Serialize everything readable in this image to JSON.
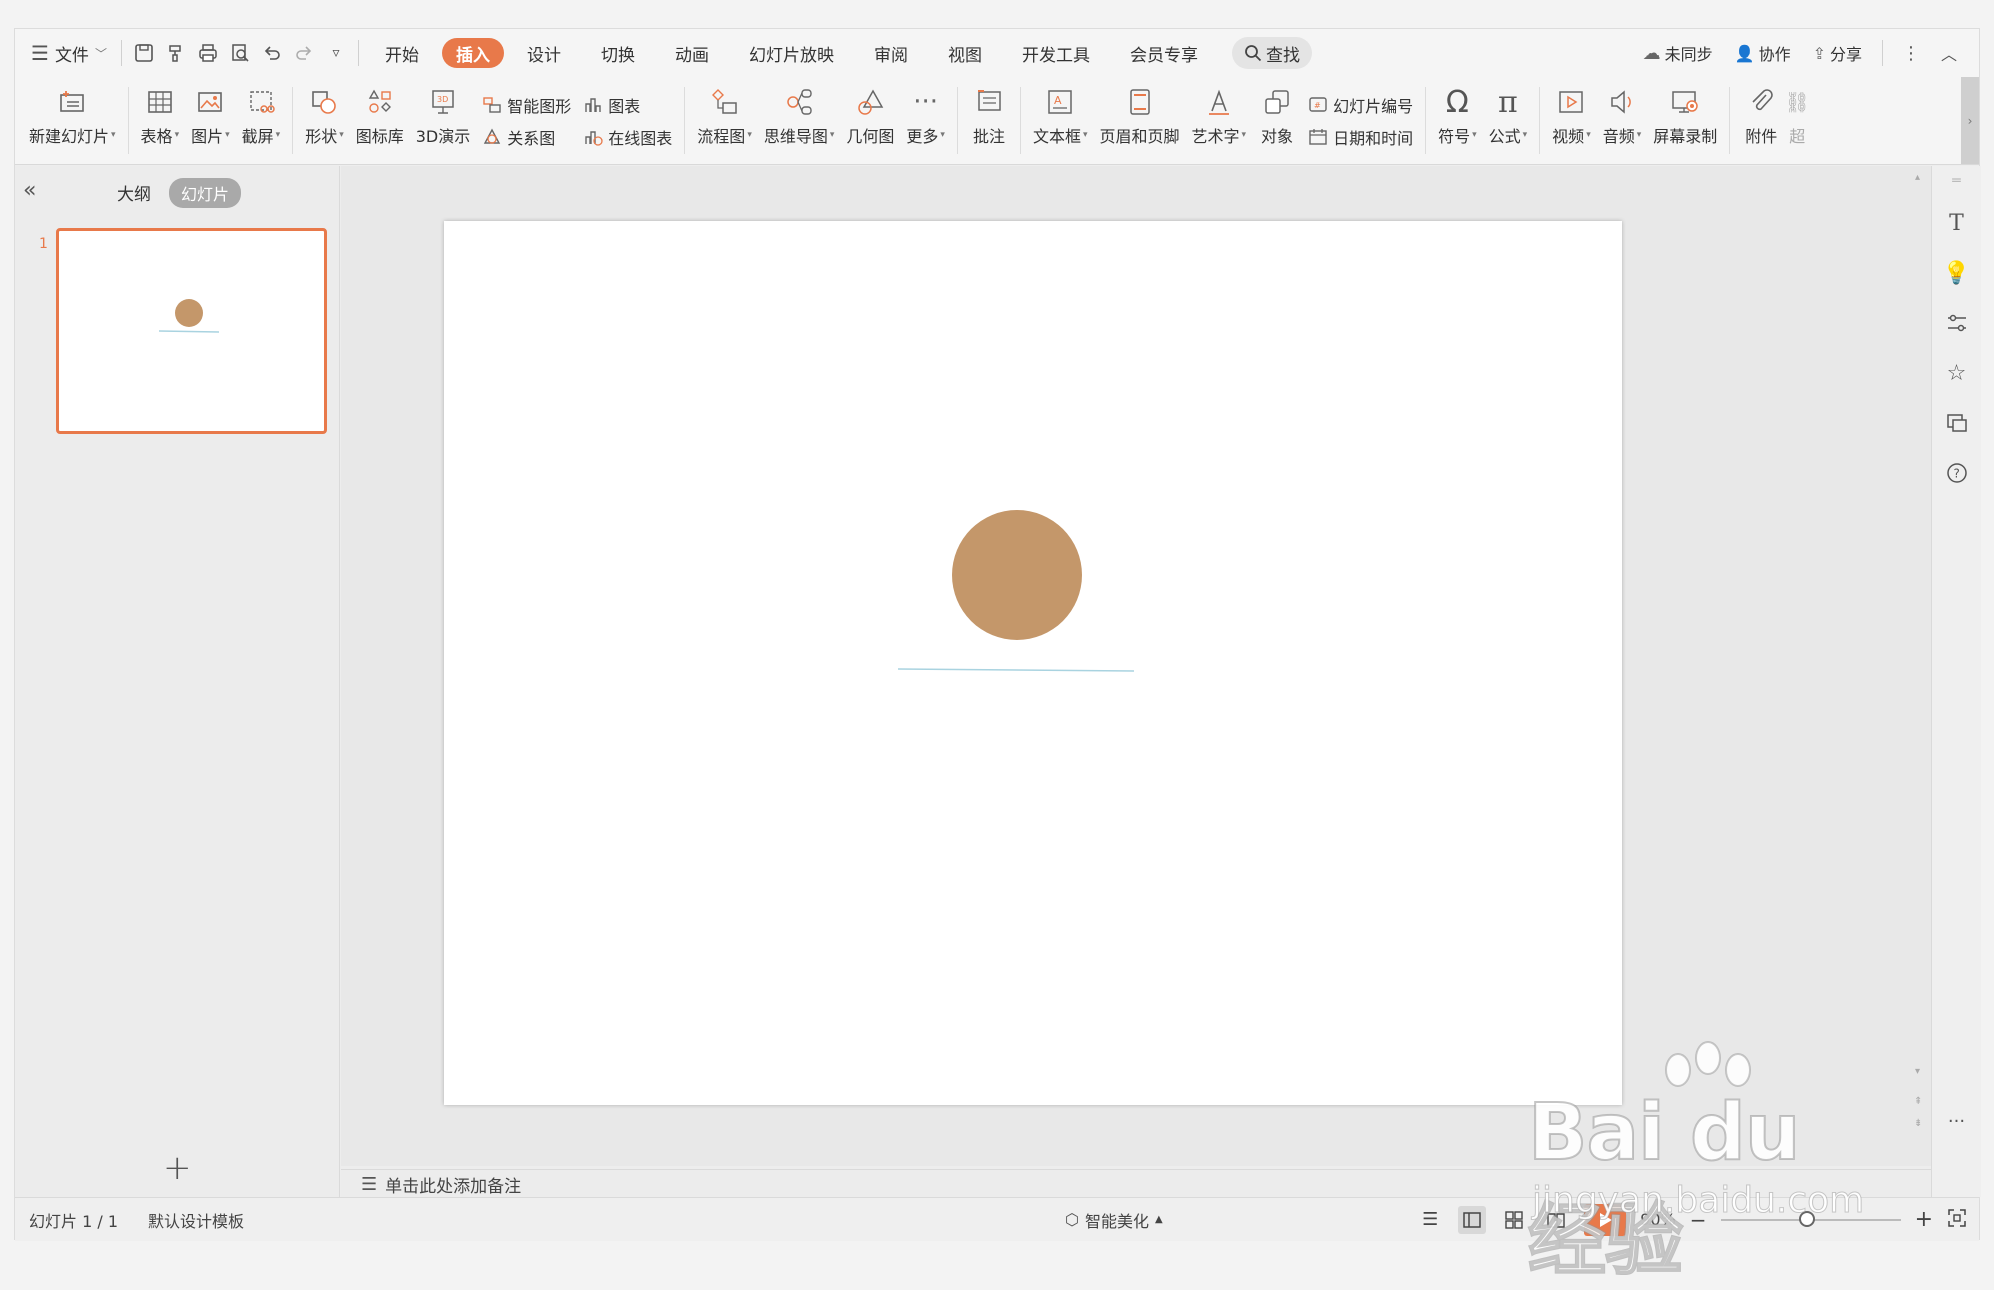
{
  "titlebar": {
    "file_menu": "文件",
    "tabs": [
      "开始",
      "插入",
      "设计",
      "切换",
      "动画",
      "幻灯片放映",
      "审阅",
      "视图",
      "开发工具",
      "会员专享"
    ],
    "active_tab": "插入",
    "search_label": "查找",
    "sync_label": "未同步",
    "collab_label": "协作",
    "share_label": "分享"
  },
  "ribbon": {
    "new_slide": "新建幻灯片",
    "table": "表格",
    "picture": "图片",
    "screenshot": "截屏",
    "shape": "形状",
    "icon_lib": "图标库",
    "demo3d": "3D演示",
    "smart_graphic": "智能图形",
    "chart": "图表",
    "relation": "关系图",
    "online_chart": "在线图表",
    "flowchart": "流程图",
    "mindmap": "思维导图",
    "geometry": "几何图",
    "more": "更多",
    "comment": "批注",
    "textbox": "文本框",
    "header_footer": "页眉和页脚",
    "wordart": "艺术字",
    "object": "对象",
    "slide_number": "幻灯片编号",
    "date_time": "日期和时间",
    "symbol": "符号",
    "formula": "公式",
    "video": "视频",
    "audio": "音频",
    "screen_record": "屏幕录制",
    "attachment": "附件",
    "hyperlink_partial": "超"
  },
  "left_panel": {
    "outline_tab": "大纲",
    "slides_tab": "幻灯片",
    "slide_index": "1"
  },
  "notes": {
    "placeholder": "单击此处添加备注"
  },
  "statusbar": {
    "slide_counter": "幻灯片 1 / 1",
    "template": "默认设计模板",
    "beautify": "智能美化",
    "zoom": "90%"
  },
  "slide": {
    "circle_color": "#c4976a",
    "line_color": "#a9d3e0"
  },
  "watermark": {
    "brand": "Bai du 经验",
    "url": "jingyan.baidu.com"
  }
}
